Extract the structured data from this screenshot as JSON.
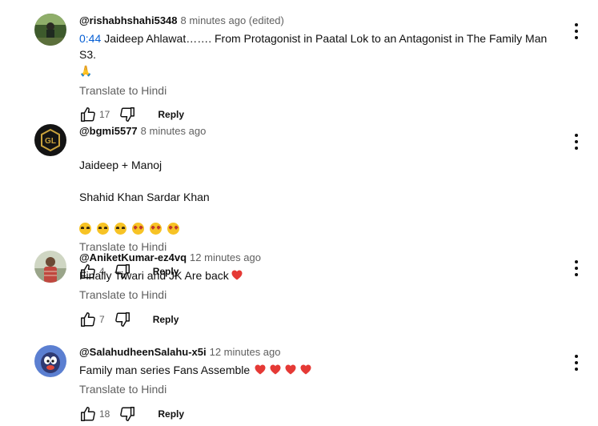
{
  "comments": [
    {
      "author": "@rishabhshahi5348",
      "time": "8 minutes ago (edited)",
      "timestamp": "0:44",
      "text": "Jaideep Ahlawat……. From Protagonist in Paatal Lok to an Antagonist in The Family Man S3.",
      "emoji": "🙏",
      "translate": "Translate to Hindi",
      "likes": "17",
      "reply": "Reply"
    },
    {
      "author": "@bgmi5577",
      "time": "8 minutes ago",
      "text_lines": [
        "Jaideep + Manoj",
        "Shahid Khan Sardar Khan"
      ],
      "emojis": [
        "🤩",
        "🤩",
        "🤩",
        "😍",
        "😍",
        "😍"
      ],
      "translate": "Translate to Hindi",
      "likes": "4",
      "reply": "Reply"
    },
    {
      "author": "@AniketKumar-ez4vq",
      "time": "12 minutes ago",
      "text": "Finally Tiwari and JK Are back",
      "emoji": "❤️",
      "translate": "Translate to Hindi",
      "likes": "7",
      "reply": "Reply"
    },
    {
      "author": "@SalahudheenSalahu-x5i",
      "time": "12 minutes ago",
      "text": "Family man series Fans Assemble",
      "emojis": [
        "❤️",
        "❤️",
        "❤️",
        "❤️"
      ],
      "translate": "Translate to Hindi",
      "likes": "18",
      "reply": "Reply"
    }
  ],
  "icons": {
    "like": "thumbs-up-icon",
    "dislike": "thumbs-down-icon",
    "more": "more-vert-icon"
  },
  "colors": {
    "link": "#065fd4",
    "secondary": "#606060",
    "heart": "#e53935"
  }
}
